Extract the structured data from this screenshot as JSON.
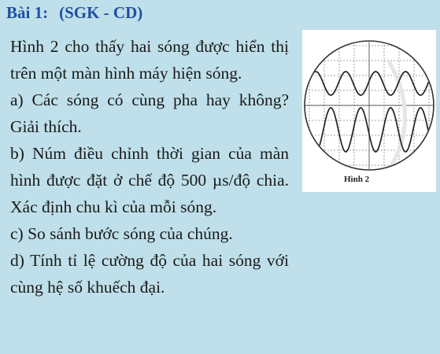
{
  "heading": {
    "label": "Bài 1:",
    "source": "(SGK - CD)"
  },
  "paragraphs": [
    "Hình 2 cho thấy hai sóng được hiển thị trên một màn hình máy hiện sóng.",
    "a) Các sóng có cùng pha hay không? Giải thích.",
    "b) Núm điều chỉnh thời gian của màn hình được đặt ở chế độ 500 µs/độ chia. Xác định chu kì của mỗi sóng.",
    "c) So sánh bước sóng của chúng.",
    "d) Tính tỉ lệ cường độ của hai sóng với cùng hệ số khuếch đại."
  ],
  "figure": {
    "caption": "Hình 2"
  },
  "colors": {
    "background": "#bfe0ea",
    "heading": "#1f4fa3"
  }
}
